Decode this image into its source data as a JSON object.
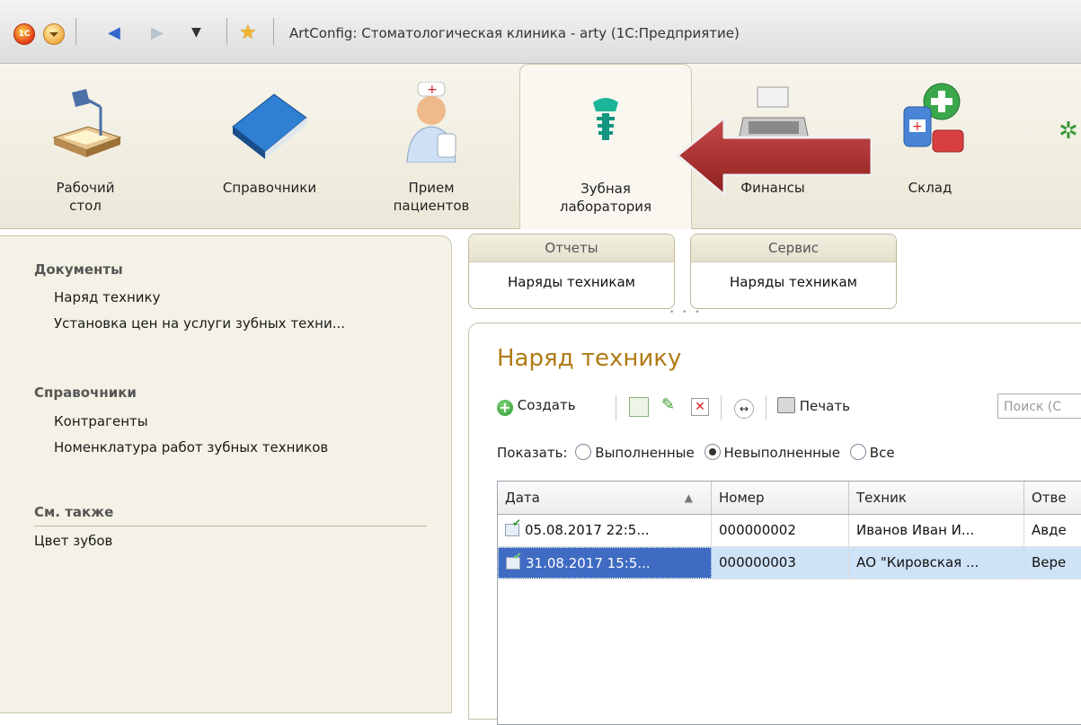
{
  "window": {
    "title": "ArtConfig: Стоматологическая клиника - arty  (1С:Предприятие)",
    "logo_text": "1С"
  },
  "sections": [
    {
      "label_line1": "Рабочий",
      "label_line2": "стол",
      "icon": "desk-lamp-icon"
    },
    {
      "label_line1": "Справочники",
      "label_line2": "",
      "icon": "book-icon"
    },
    {
      "label_line1": "Прием",
      "label_line2": "пациентов",
      "icon": "nurse-icon"
    },
    {
      "label_line1": "Зубная",
      "label_line2": "лаборатория",
      "icon": "tooth-implant-icon"
    },
    {
      "label_line1": "Финансы",
      "label_line2": "",
      "icon": "cash-register-icon"
    },
    {
      "label_line1": "Склад",
      "label_line2": "",
      "icon": "medicine-bottles-icon"
    }
  ],
  "nav": {
    "documents_header": "Документы",
    "documents": [
      "Наряд технику",
      "Установка цен на услуги зубных техни..."
    ],
    "catalogs_header": "Справочники",
    "catalogs": [
      "Контрагенты",
      "Номенклатура работ зубных техников"
    ],
    "see_also_header": "См. также",
    "see_also": [
      "Цвет зубов"
    ]
  },
  "commands": {
    "reports_header": "Отчеты",
    "reports_item": "Наряды техникам",
    "service_header": "Сервис",
    "service_item": "Наряды техникам"
  },
  "form": {
    "title": "Наряд технику",
    "create_label": "Создать",
    "print_label": "Печать",
    "search_placeholder": "Поиск (С",
    "show_label": "Показать:",
    "filters": [
      {
        "label": "Выполненные",
        "selected": false
      },
      {
        "label": "Невыполненные",
        "selected": true
      },
      {
        "label": "Все",
        "selected": false
      }
    ]
  },
  "table": {
    "columns": [
      "Дата",
      "Номер",
      "Техник",
      "Отве"
    ],
    "rows": [
      {
        "date": "05.08.2017 22:5...",
        "number": "000000002",
        "tech": "Иванов Иван И...",
        "resp": "Авде",
        "selected": false
      },
      {
        "date": "31.08.2017 15:5...",
        "number": "000000003",
        "tech": "АО \"Кировская ...",
        "resp": "Вере",
        "selected": true
      }
    ]
  },
  "colors": {
    "accent_title": "#b07a14",
    "arrow_red": "#a82a2a",
    "selected_row": "#cfe3f7",
    "selected_cell": "#3f6bc3"
  }
}
